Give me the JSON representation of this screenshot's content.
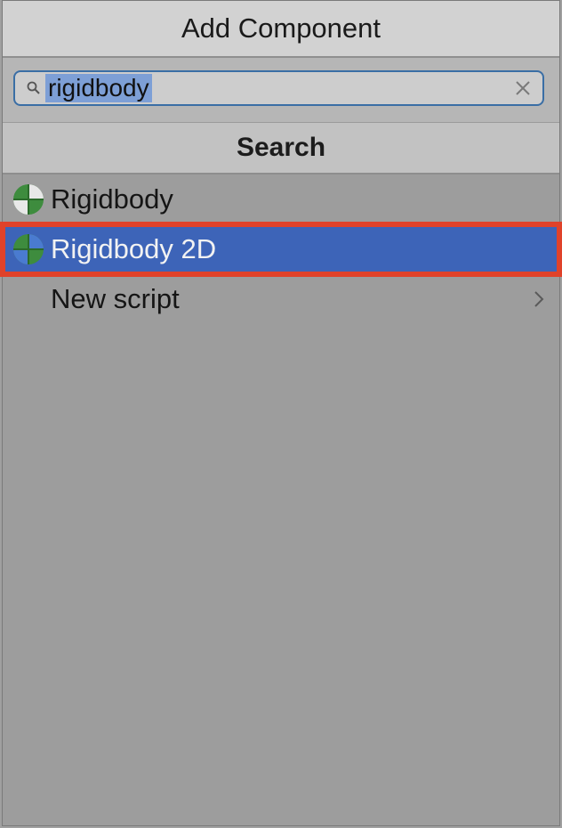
{
  "header": {
    "title": "Add Component"
  },
  "search": {
    "value": "rigidbody",
    "icons": {
      "search": "search-icon",
      "clear": "clear-icon"
    }
  },
  "section": {
    "title": "Search"
  },
  "results": [
    {
      "label": "Rigidbody",
      "icon": "rigidbody-icon",
      "selected": false
    },
    {
      "label": "Rigidbody 2D",
      "icon": "rigidbody-2d-icon",
      "selected": true
    },
    {
      "label": "New script",
      "icon": "",
      "selected": false,
      "has_submenu": true
    }
  ],
  "colors": {
    "selection": "#3d64b8",
    "highlight_outline": "#e0422a",
    "icon_green": "#3e8c3e"
  }
}
